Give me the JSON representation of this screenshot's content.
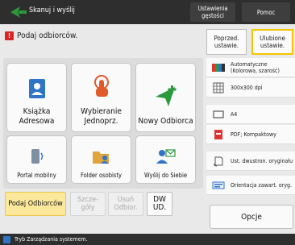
{
  "header": {
    "title": "Skanuj i wyślij",
    "density_button": "Ustawienia gęstości",
    "help_button": "Pomoc"
  },
  "instruction": "Podaj odbiorców.",
  "settings_buttons": {
    "previous": "Poprzed. ustawie.",
    "favorite": "Ulubione ustawie."
  },
  "tiles": {
    "address_book": "Książka Adresowa",
    "one_touch": "Wybieranie Jednoprz.",
    "new_dest": "Nowy Odbiorca",
    "mobile_portal": "Portal mobilny",
    "personal_folder": "Folder osobisty",
    "send_to_myself": "Wyślij do Siebie"
  },
  "tabs": {
    "specify": "Podaj Odbiorców",
    "details": "Szcze-góły",
    "delete": "Usuń Odbior.",
    "dwud": "DW UD."
  },
  "right_settings": [
    {
      "icon": "color-icon",
      "text": "Automatyczne (Kolorowa, szarość)"
    },
    {
      "icon": "resolution-icon",
      "text": "300x300 dpi"
    },
    {
      "icon": "size-icon",
      "text": "A4"
    },
    {
      "icon": "file-format-icon",
      "text": "PDF; Kompaktowy"
    },
    {
      "icon": "duplex-icon",
      "text": "Ust. dwustron. oryginału"
    },
    {
      "icon": "orientation-icon",
      "text": "Orientacja zawart. oryg."
    }
  ],
  "options_button": "Opcje",
  "status": "Tryb Zarządzania systemem.",
  "colors": {
    "accent": "#f3c400",
    "topbar": "#2e2e2e",
    "green": "#2c9a3c",
    "blue": "#2f74c6",
    "orange": "#e05a2a"
  }
}
